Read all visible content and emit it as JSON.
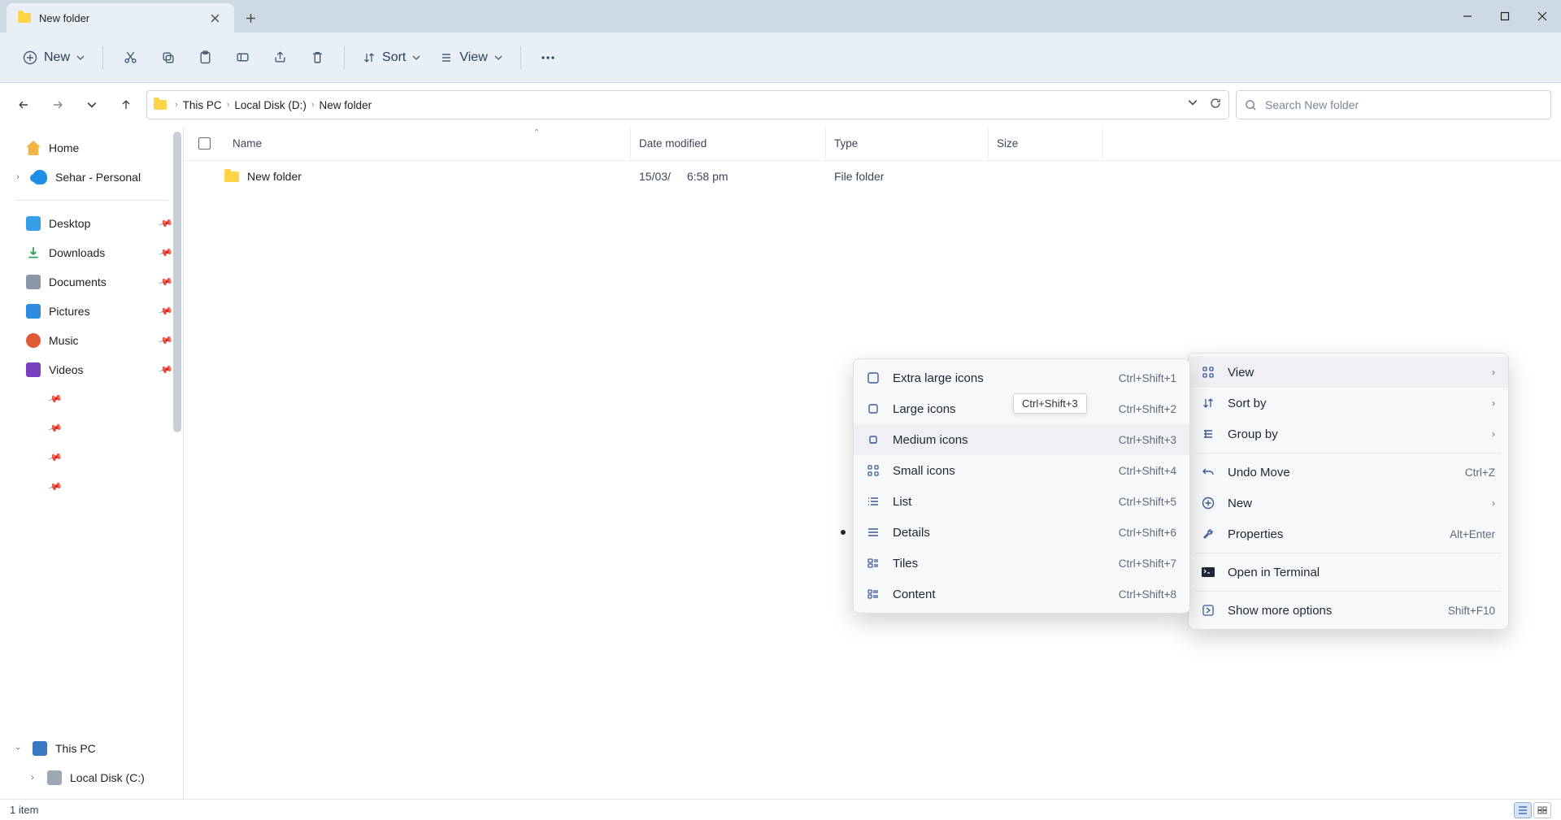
{
  "tab": {
    "title": "New folder"
  },
  "toolbar": {
    "new": "New",
    "sort": "Sort",
    "view": "View"
  },
  "breadcrumb": {
    "seg1": "This PC",
    "seg2": "Local Disk (D:)",
    "seg3": "New folder"
  },
  "search": {
    "placeholder": "Search New folder"
  },
  "sidebar": {
    "home": "Home",
    "sehar": "Sehar - Personal",
    "desktop": "Desktop",
    "downloads": "Downloads",
    "documents": "Documents",
    "pictures": "Pictures",
    "music": "Music",
    "videos": "Videos",
    "thispc": "This PC",
    "localc": "Local Disk (C:)"
  },
  "columns": {
    "name": "Name",
    "date": "Date modified",
    "type": "Type",
    "size": "Size"
  },
  "rows": [
    {
      "name": "New folder",
      "date1": "15/03/",
      "date2": "6:58 pm",
      "type": "File folder"
    }
  ],
  "context": {
    "view": "View",
    "sortby": "Sort by",
    "groupby": "Group by",
    "undo": "Undo Move",
    "undo_s": "Ctrl+Z",
    "new": "New",
    "props": "Properties",
    "props_s": "Alt+Enter",
    "terminal": "Open in Terminal",
    "more": "Show more options",
    "more_s": "Shift+F10"
  },
  "viewsub": {
    "xl": "Extra large icons",
    "xl_s": "Ctrl+Shift+1",
    "l": "Large icons",
    "l_s": "Ctrl+Shift+2",
    "m": "Medium icons",
    "m_s": "Ctrl+Shift+3",
    "s": "Small icons",
    "s_s": "Ctrl+Shift+4",
    "list": "List",
    "list_s": "Ctrl+Shift+5",
    "det": "Details",
    "det_s": "Ctrl+Shift+6",
    "tiles": "Tiles",
    "tiles_s": "Ctrl+Shift+7",
    "content": "Content",
    "content_s": "Ctrl+Shift+8"
  },
  "tooltip": "Ctrl+Shift+3",
  "status": {
    "count": "1 item"
  }
}
